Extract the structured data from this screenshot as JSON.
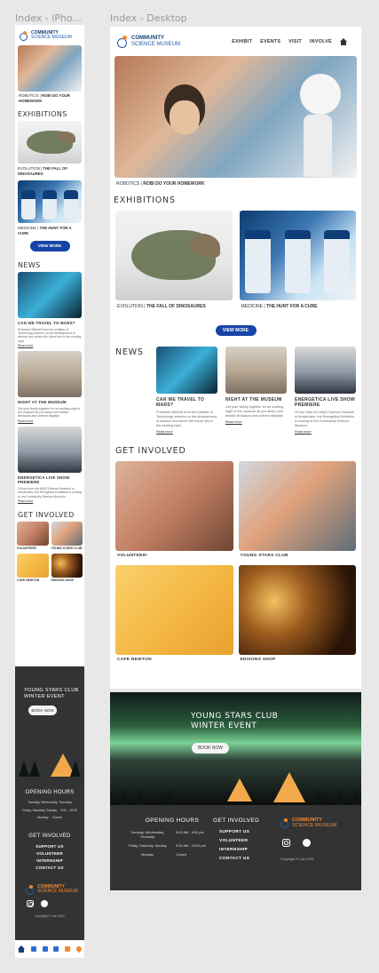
{
  "frames": {
    "phone_label": "Index - iPho...",
    "desktop_label": "Index - Desktop"
  },
  "brand": {
    "line1": "COMMUNITY",
    "line2": "SCIENCE MUSEUM"
  },
  "nav": [
    "EXHIBIT",
    "EVENTS",
    "VISIT",
    "INVOLVE"
  ],
  "hero": {
    "category": "ROBOTICS |",
    "title": "ROBI DO YOUR HOMEWORK"
  },
  "exhibitions": {
    "heading": "EXHIBITIONS",
    "items": [
      {
        "category": "EVOLUTION |",
        "title": "THE FALL OF DINOSAURES"
      },
      {
        "category": "MEDICINE |",
        "title": "THE HUNT FOR A CURE"
      }
    ],
    "view_more": "VIEW MORE"
  },
  "news": {
    "heading": "NEWS",
    "items": [
      {
        "title": "CAN WE TRAVEL TO MARS?",
        "desc": "Professor Mitchell from the Institute of Technology lectures on the development of devices and where the future lies in the exciting topic",
        "more": "Read more"
      },
      {
        "title": "NIGHT AT THE MUSEUM",
        "desc": "Get your family together for an exciting night in the museum as you sleep over beside dinosaurs and science displays",
        "more": "Read more"
      },
      {
        "title": "ENERGETICA LIVE SHOW PREMIERE",
        "desc": "Of tour from the MIAS Science Museum in Amsterdam, the Energetica Exhibition is coming to the Community Science Museum",
        "more": "Read more"
      }
    ]
  },
  "involved": {
    "heading": "GET INVOLVED",
    "items": [
      "VOLUNTEER!",
      "YOUNG STARS CLUB",
      "CAFE NEWTON",
      "EDISONS SHOP"
    ],
    "phone_items": [
      "VOLUNTEER!",
      "YOUNG STARS CLUB",
      "CAFE NEWTON",
      "EDISONS SHOP"
    ]
  },
  "banner": {
    "line1": "YOUNG STARS CLUB",
    "line2": "WINTER EVENT",
    "button": "BOOK NOW"
  },
  "footer": {
    "hours_heading": "OPENING HOURS",
    "hours": [
      {
        "days": "Tuesday, Wednesday, Thursday",
        "time": "9:00 AM - 6:00 pm"
      },
      {
        "days": "Friday, Saturday, Sunday",
        "time": "9:00 AM - 10:00 pm"
      },
      {
        "days": "Monday",
        "time": "Closed"
      }
    ],
    "phone_hours": [
      {
        "days": "Tuesday, Wednesday, Thursday",
        "time": ""
      },
      {
        "days": "Friday, Saturday, Sunday",
        "time": "9:00 - 10:00"
      },
      {
        "days": "Monday",
        "time": "Closed"
      }
    ],
    "involved_heading": "GET INVOLVED",
    "links": [
      "SUPPORT US",
      "VOLUNTEER",
      "INTERNSHIP",
      "CONTACT US"
    ],
    "copyright": "Copyright   ©   Lulu 2021"
  },
  "icons": [
    "home-icon",
    "instagram-icon",
    "facebook-icon"
  ],
  "colors": {
    "accent": "#1744a6",
    "brand_orange": "#f0892f",
    "footer_bg": "#333334"
  }
}
